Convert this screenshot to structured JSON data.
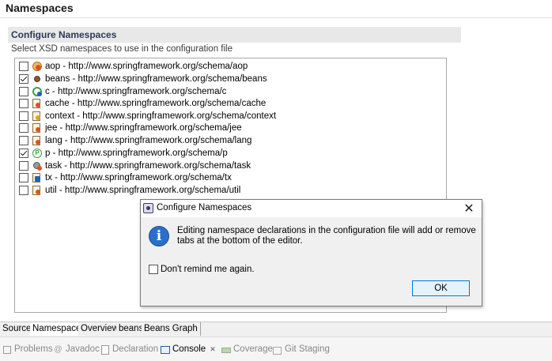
{
  "page": {
    "title": "Namespaces"
  },
  "section": {
    "title": "Configure Namespaces",
    "description": "Select XSD namespaces to use in the configuration file"
  },
  "namespaces": [
    {
      "label": "aop - http://www.springframework.org/schema/aop",
      "checked": false,
      "icon": "aop-icon"
    },
    {
      "label": "beans - http://www.springframework.org/schema/beans",
      "checked": true,
      "icon": "bean-icon"
    },
    {
      "label": "c - http://www.springframework.org/schema/c",
      "checked": false,
      "icon": "c-namespace-icon"
    },
    {
      "label": "cache - http://www.springframework.org/schema/cache",
      "checked": false,
      "icon": "xsd-file-icon"
    },
    {
      "label": "context - http://www.springframework.org/schema/context",
      "checked": false,
      "icon": "xsd-file-icon"
    },
    {
      "label": "jee - http://www.springframework.org/schema/jee",
      "checked": false,
      "icon": "xsd-file-icon"
    },
    {
      "label": "lang - http://www.springframework.org/schema/lang",
      "checked": false,
      "icon": "xsd-file-icon"
    },
    {
      "label": "p - http://www.springframework.org/schema/p",
      "checked": true,
      "icon": "p-namespace-icon"
    },
    {
      "label": "task - http://www.springframework.org/schema/task",
      "checked": false,
      "icon": "task-icon"
    },
    {
      "label": "tx - http://www.springframework.org/schema/tx",
      "checked": false,
      "icon": "xsd-file-icon"
    },
    {
      "label": "util - http://www.springframework.org/schema/util",
      "checked": false,
      "icon": "xsd-file-icon"
    }
  ],
  "editor_tabs": [
    {
      "label": "Source",
      "active": false
    },
    {
      "label": "Namespaces",
      "active": true
    },
    {
      "label": "Overview",
      "active": false
    },
    {
      "label": "beans",
      "active": false
    },
    {
      "label": "Beans Graph",
      "active": false
    }
  ],
  "views": [
    {
      "label": "Problems",
      "icon": "problems-icon",
      "active": false
    },
    {
      "label": "Javadoc",
      "icon": "javadoc-icon",
      "active": false
    },
    {
      "label": "Declaration",
      "icon": "declaration-icon",
      "active": false
    },
    {
      "label": "Console",
      "icon": "console-icon",
      "active": true
    },
    {
      "label": "Coverage",
      "icon": "coverage-icon",
      "active": false
    },
    {
      "label": "Git Staging",
      "icon": "git-staging-icon",
      "active": false
    }
  ],
  "dialog": {
    "title": "Configure Namespaces",
    "close_glyph": "✕",
    "message": "Editing namespace declarations in the configuration file will add or remove tabs at the bottom of the editor.",
    "checkbox_label": "Don't remind me again.",
    "checkbox_checked": false,
    "ok_label": "OK",
    "info_glyph": "i"
  },
  "console_tab_close_glyph": "✕",
  "colors": {
    "accent": "#0078d7",
    "info": "#2a6fc9",
    "section_bg": "#e8e8e8"
  }
}
